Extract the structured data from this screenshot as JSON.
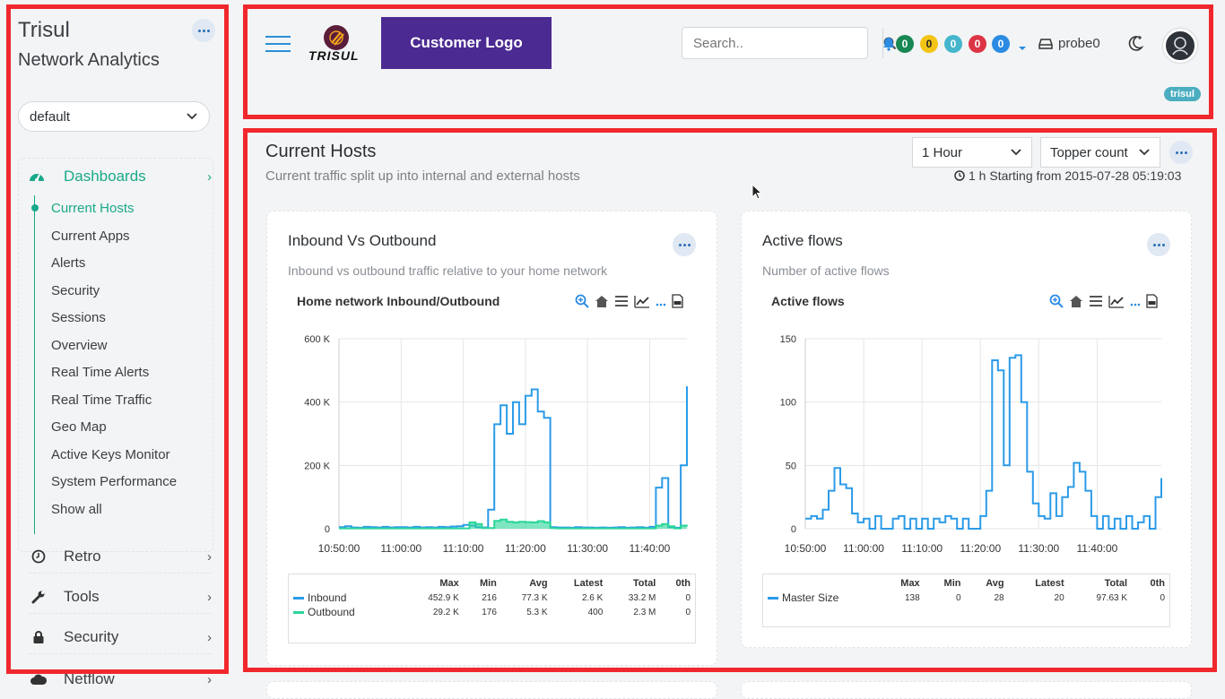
{
  "sidebar": {
    "brand_title": "Trisul",
    "brand_subtitle": "Network Analytics",
    "context_select": "default",
    "section_label": "Dashboards",
    "items": [
      {
        "label": "Current Hosts",
        "active": true
      },
      {
        "label": "Current Apps"
      },
      {
        "label": "Alerts"
      },
      {
        "label": "Security"
      },
      {
        "label": "Sessions"
      },
      {
        "label": "Overview"
      },
      {
        "label": "Real Time Alerts"
      },
      {
        "label": "Real Time Traffic"
      },
      {
        "label": "Geo Map"
      },
      {
        "label": "Active Keys Monitor"
      },
      {
        "label": "System Performance"
      },
      {
        "label": "Show all"
      }
    ],
    "groups": [
      {
        "label": "Retro",
        "icon": "clock-icon"
      },
      {
        "label": "Tools",
        "icon": "wrench-icon"
      },
      {
        "label": "Security",
        "icon": "lock-icon"
      },
      {
        "label": "Netflow",
        "icon": "cloud-icon"
      }
    ]
  },
  "header": {
    "logo_text": "TRISUL",
    "customer_logo": "Customer Logo",
    "search_placeholder": "Search..",
    "badges": [
      {
        "value": "0",
        "color": "#198754"
      },
      {
        "value": "0",
        "color": "#f4c415"
      },
      {
        "value": "0",
        "color": "#45b6cc"
      },
      {
        "value": "0",
        "color": "#dc3545"
      },
      {
        "value": "0",
        "color": "#2b8be3"
      }
    ],
    "probe": "probe0",
    "user_pill": "trisul"
  },
  "main": {
    "title": "Current Hosts",
    "subtitle": "Current traffic split up into internal and external hosts",
    "time_select": "1 Hour",
    "sort_select": "Topper count",
    "time_note": "1 h Starting from 2015-07-28 05:19:03"
  },
  "cards": [
    {
      "title": "Inbound Vs Outbound",
      "subtitle": "Inbound vs outbound traffic relative to your home network",
      "chart_title": "Home network Inbound/Outbound",
      "table_headers": [
        "",
        "Max",
        "Min",
        "Avg",
        "Latest",
        "Total",
        "0th"
      ],
      "rows": [
        {
          "name": "Inbound",
          "color": "#2b9be8",
          "cells": [
            "452.9 K",
            "216",
            "77.3 K",
            "2.6 K",
            "33.2 M",
            "0"
          ]
        },
        {
          "name": "Outbound",
          "color": "#2ad69a",
          "cells": [
            "29.2 K",
            "176",
            "5.3 K",
            "400",
            "2.3 M",
            "0"
          ]
        }
      ]
    },
    {
      "title": "Active flows",
      "subtitle": "Number of active flows",
      "chart_title": "Active flows",
      "table_headers": [
        "",
        "Max",
        "Min",
        "Avg",
        "Latest",
        "Total",
        "0th"
      ],
      "rows": [
        {
          "name": "Master Size",
          "color": "#2b9be8",
          "cells": [
            "138",
            "0",
            "28",
            "20",
            "97.63 K",
            "0"
          ]
        }
      ]
    }
  ],
  "chart_data": [
    {
      "type": "line",
      "title": "Home network Inbound/Outbound",
      "x": [
        "10:50:00",
        "10:51:00",
        "10:52:00",
        "10:53:00",
        "10:54:00",
        "10:55:00",
        "10:56:00",
        "10:57:00",
        "10:58:00",
        "10:59:00",
        "11:00:00",
        "11:01:00",
        "11:02:00",
        "11:03:00",
        "11:04:00",
        "11:05:00",
        "11:06:00",
        "11:07:00",
        "11:08:00",
        "11:09:00",
        "11:10:00",
        "11:11:00",
        "11:12:00",
        "11:13:00",
        "11:14:00",
        "11:15:00",
        "11:16:00",
        "11:17:00",
        "11:18:00",
        "11:19:00",
        "11:20:00",
        "11:21:00",
        "11:22:00",
        "11:23:00",
        "11:24:00",
        "11:25:00",
        "11:26:00",
        "11:27:00",
        "11:28:00",
        "11:29:00",
        "11:30:00",
        "11:31:00",
        "11:32:00",
        "11:33:00",
        "11:34:00",
        "11:35:00",
        "11:36:00",
        "11:37:00",
        "11:38:00",
        "11:39:00",
        "11:40:00",
        "11:41:00",
        "11:42:00",
        "11:43:00",
        "11:44:00",
        "11:45:00",
        "11:46:00"
      ],
      "xticks": [
        "10:50:00",
        "11:00:00",
        "11:10:00",
        "11:20:00",
        "11:30:00",
        "11:40:00"
      ],
      "yticks": [
        "0",
        "200 K",
        "400 K",
        "600 K"
      ],
      "ylim": [
        0,
        600000
      ],
      "series": [
        {
          "name": "Inbound",
          "color": "#2b9be8",
          "values": [
            5000,
            8000,
            4000,
            3000,
            6000,
            5000,
            4000,
            6000,
            4000,
            5000,
            5000,
            4000,
            6000,
            4000,
            5000,
            4000,
            6000,
            5000,
            7000,
            8000,
            12000,
            10000,
            5000,
            4000,
            60000,
            330000,
            390000,
            300000,
            400000,
            330000,
            420000,
            440000,
            370000,
            350000,
            5000,
            4000,
            4000,
            3000,
            5000,
            4000,
            4000,
            3000,
            4000,
            3000,
            4000,
            5000,
            3000,
            4000,
            5000,
            3000,
            6000,
            130000,
            160000,
            5000,
            3000,
            200000,
            450000
          ]
        },
        {
          "name": "Outbound",
          "color": "#2ad69a",
          "values": [
            1000,
            1000,
            1000,
            1000,
            1000,
            1000,
            1000,
            1000,
            1000,
            1000,
            1000,
            1000,
            1000,
            1000,
            1000,
            1000,
            1000,
            1000,
            1000,
            1000,
            1000,
            20000,
            15000,
            2000,
            2000,
            25000,
            29000,
            22000,
            20000,
            22000,
            21000,
            20000,
            24000,
            20000,
            2000,
            1000,
            1000,
            1000,
            1000,
            1000,
            1000,
            1000,
            1000,
            1000,
            1000,
            1000,
            1000,
            1000,
            1000,
            1000,
            1000,
            10000,
            15000,
            8000,
            1000,
            10000,
            12000
          ]
        }
      ]
    },
    {
      "type": "line",
      "title": "Active flows",
      "x": [
        "10:50:00",
        "10:51:00",
        "10:52:00",
        "10:53:00",
        "10:54:00",
        "10:55:00",
        "10:56:00",
        "10:57:00",
        "10:58:00",
        "10:59:00",
        "11:00:00",
        "11:01:00",
        "11:02:00",
        "11:03:00",
        "11:04:00",
        "11:05:00",
        "11:06:00",
        "11:07:00",
        "11:08:00",
        "11:09:00",
        "11:10:00",
        "11:11:00",
        "11:12:00",
        "11:13:00",
        "11:14:00",
        "11:15:00",
        "11:16:00",
        "11:17:00",
        "11:18:00",
        "11:19:00",
        "11:20:00",
        "11:21:00",
        "11:22:00",
        "11:23:00",
        "11:24:00",
        "11:25:00",
        "11:26:00",
        "11:27:00",
        "11:28:00",
        "11:29:00",
        "11:30:00",
        "11:31:00",
        "11:32:00",
        "11:33:00",
        "11:34:00",
        "11:35:00",
        "11:36:00",
        "11:37:00",
        "11:38:00",
        "11:39:00",
        "11:40:00",
        "11:41:00",
        "11:42:00",
        "11:43:00",
        "11:44:00",
        "11:45:00",
        "11:46:00",
        "11:47:00",
        "11:48:00",
        "11:49:00",
        "11:50:00",
        "11:51:00"
      ],
      "xticks": [
        "10:50:00",
        "11:00:00",
        "11:10:00",
        "11:20:00",
        "11:30:00",
        "11:40:00"
      ],
      "yticks": [
        "0",
        "50",
        "100",
        "150"
      ],
      "ylim": [
        0,
        150
      ],
      "series": [
        {
          "name": "Master Size",
          "color": "#2b9be8",
          "values": [
            8,
            10,
            8,
            15,
            30,
            48,
            35,
            32,
            12,
            5,
            8,
            0,
            10,
            0,
            0,
            8,
            10,
            0,
            8,
            0,
            8,
            0,
            8,
            5,
            10,
            8,
            0,
            8,
            0,
            0,
            10,
            30,
            133,
            125,
            50,
            135,
            137,
            100,
            45,
            20,
            10,
            8,
            28,
            10,
            25,
            33,
            52,
            45,
            30,
            10,
            0,
            10,
            0,
            8,
            0,
            10,
            0,
            5,
            10,
            0,
            25,
            40
          ]
        }
      ]
    }
  ]
}
